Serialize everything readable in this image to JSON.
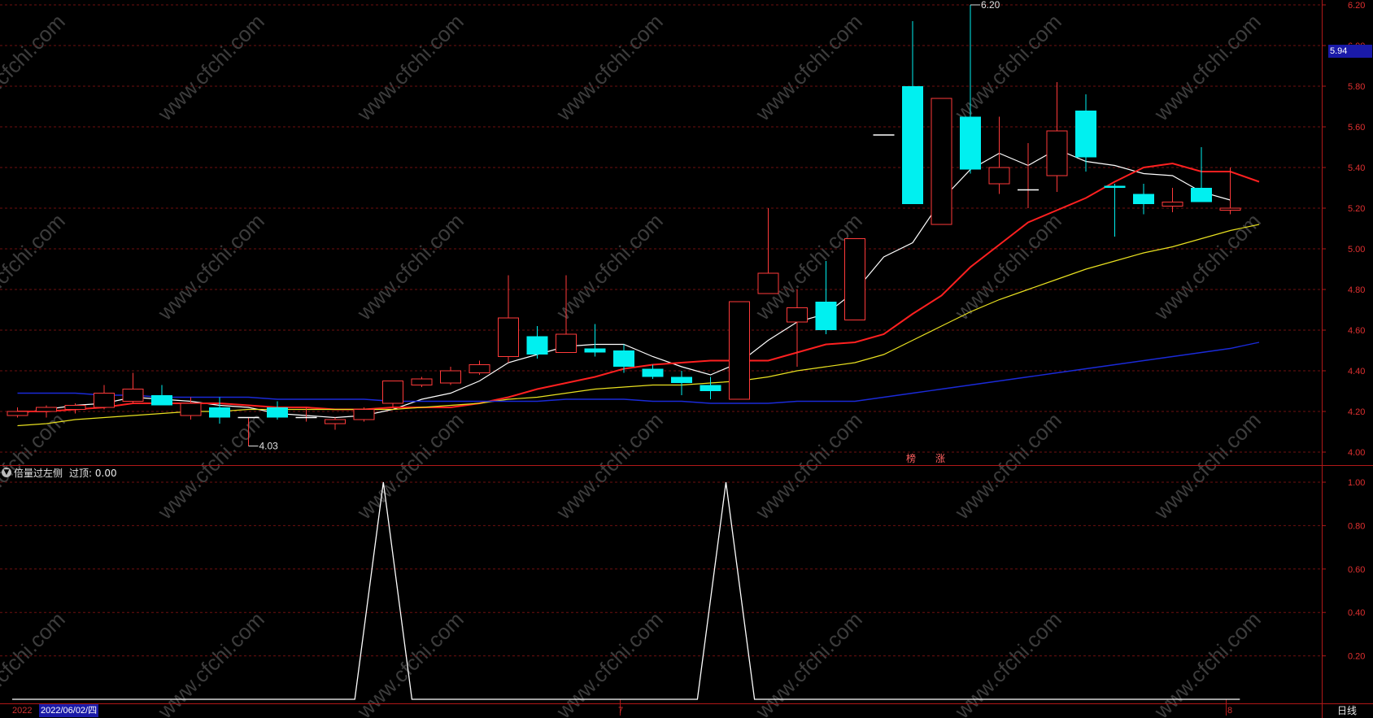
{
  "colors": {
    "background": "#000000",
    "grid": "#6e1010",
    "axis": "#b01818",
    "up_candle": "#ff3a3a",
    "down_candle": "#00f0f0",
    "ma5": "#ffffff",
    "ma10": "#ff2020",
    "ma20": "#e8e020",
    "ma60": "#1a2ad8",
    "indicator": "#ffffff",
    "price_tag_bg": "#1a1aa8"
  },
  "watermark_text": "www.cfchi.com",
  "price_tag": "5.94",
  "markers": [
    "榜",
    "涨"
  ],
  "indicator_panel": {
    "name": "倍量过左侧",
    "value_label": "过顶: 0.00",
    "collapse_icon": "chevron-down-icon"
  },
  "bottom_axis": {
    "start_label": "2022",
    "cursor_date": "2022/06/02/四",
    "mid_label": "7",
    "end_label": "8",
    "period": "日线"
  },
  "chart_data": [
    {
      "type": "candlestick",
      "ylim": [
        3.95,
        6.22
      ],
      "yticks": [
        "4.00",
        "4.20",
        "4.40",
        "4.60",
        "4.80",
        "5.00",
        "5.20",
        "5.40",
        "5.60",
        "5.80",
        "6.00",
        "6.20"
      ],
      "grid": true,
      "annotations": [
        {
          "text": "6.20",
          "index": 33,
          "value": 6.2
        },
        {
          "text": "4.03",
          "index": 8,
          "value": 4.03
        }
      ],
      "candles": [
        {
          "o": 4.18,
          "h": 4.22,
          "l": 4.17,
          "c": 4.2
        },
        {
          "o": 4.2,
          "h": 4.23,
          "l": 4.17,
          "c": 4.22
        },
        {
          "o": 4.21,
          "h": 4.24,
          "l": 4.19,
          "c": 4.23
        },
        {
          "o": 4.22,
          "h": 4.33,
          "l": 4.21,
          "c": 4.29
        },
        {
          "o": 4.25,
          "h": 4.39,
          "l": 4.24,
          "c": 4.31
        },
        {
          "o": 4.28,
          "h": 4.33,
          "l": 4.23,
          "c": 4.23
        },
        {
          "o": 4.18,
          "h": 4.27,
          "l": 4.16,
          "c": 4.24
        },
        {
          "o": 4.22,
          "h": 4.27,
          "l": 4.14,
          "c": 4.17
        },
        {
          "o": 4.17,
          "h": 4.17,
          "l": 4.03,
          "c": 4.17
        },
        {
          "o": 4.22,
          "h": 4.25,
          "l": 4.16,
          "c": 4.17
        },
        {
          "o": 4.17,
          "h": 4.22,
          "l": 4.15,
          "c": 4.17
        },
        {
          "o": 4.14,
          "h": 4.17,
          "l": 4.11,
          "c": 4.16
        },
        {
          "o": 4.16,
          "h": 4.22,
          "l": 4.15,
          "c": 4.21
        },
        {
          "o": 4.24,
          "h": 4.35,
          "l": 4.22,
          "c": 4.35
        },
        {
          "o": 4.33,
          "h": 4.37,
          "l": 4.32,
          "c": 4.36
        },
        {
          "o": 4.34,
          "h": 4.42,
          "l": 4.33,
          "c": 4.4
        },
        {
          "o": 4.39,
          "h": 4.45,
          "l": 4.38,
          "c": 4.43
        },
        {
          "o": 4.47,
          "h": 4.87,
          "l": 4.44,
          "c": 4.66
        },
        {
          "o": 4.57,
          "h": 4.62,
          "l": 4.46,
          "c": 4.48
        },
        {
          "o": 4.49,
          "h": 4.87,
          "l": 4.49,
          "c": 4.58
        },
        {
          "o": 4.51,
          "h": 4.63,
          "l": 4.47,
          "c": 4.49
        },
        {
          "o": 4.5,
          "h": 4.53,
          "l": 4.39,
          "c": 4.42
        },
        {
          "o": 4.41,
          "h": 4.43,
          "l": 4.36,
          "c": 4.37
        },
        {
          "o": 4.37,
          "h": 4.4,
          "l": 4.28,
          "c": 4.34
        },
        {
          "o": 4.33,
          "h": 4.37,
          "l": 4.26,
          "c": 4.3
        },
        {
          "o": 4.26,
          "h": 4.74,
          "l": 4.26,
          "c": 4.74
        },
        {
          "o": 4.78,
          "h": 5.2,
          "l": 4.78,
          "c": 4.88
        },
        {
          "o": 4.64,
          "h": 4.8,
          "l": 4.42,
          "c": 4.71
        },
        {
          "o": 4.74,
          "h": 4.94,
          "l": 4.58,
          "c": 4.6
        },
        {
          "o": 4.65,
          "h": 5.05,
          "l": 4.65,
          "c": 5.05
        },
        {
          "o": 5.56,
          "h": 5.56,
          "l": 5.56,
          "c": 5.56
        },
        {
          "o": 5.8,
          "h": 6.12,
          "l": 5.22,
          "c": 5.22
        },
        {
          "o": 5.12,
          "h": 5.74,
          "l": 5.12,
          "c": 5.74
        },
        {
          "o": 5.65,
          "h": 6.2,
          "l": 5.37,
          "c": 5.39
        },
        {
          "o": 5.32,
          "h": 5.65,
          "l": 5.27,
          "c": 5.4
        },
        {
          "o": 5.29,
          "h": 5.52,
          "l": 5.2,
          "c": 5.29
        },
        {
          "o": 5.36,
          "h": 5.82,
          "l": 5.28,
          "c": 5.58
        },
        {
          "o": 5.68,
          "h": 5.76,
          "l": 5.38,
          "c": 5.45
        },
        {
          "o": 5.31,
          "h": 5.32,
          "l": 5.06,
          "c": 5.3
        },
        {
          "o": 5.27,
          "h": 5.32,
          "l": 5.17,
          "c": 5.22
        },
        {
          "o": 5.21,
          "h": 5.3,
          "l": 5.18,
          "c": 5.23
        },
        {
          "o": 5.3,
          "h": 5.5,
          "l": 5.23,
          "c": 5.23
        },
        {
          "o": 5.19,
          "h": 5.4,
          "l": 5.17,
          "c": 5.2
        }
      ],
      "series": [
        {
          "values": [
            4.19,
            4.21,
            4.23,
            4.24,
            4.27,
            4.26,
            4.25,
            4.23,
            4.22,
            4.19,
            4.18,
            4.17,
            4.18,
            4.21,
            4.26,
            4.29,
            4.35,
            4.44,
            4.48,
            4.52,
            4.53,
            4.53,
            4.47,
            4.42,
            4.38,
            4.44,
            4.55,
            4.64,
            4.68,
            4.79,
            4.96,
            5.03,
            5.24,
            5.39,
            5.47,
            5.41,
            5.49,
            5.43,
            5.41,
            5.37,
            5.36,
            5.28,
            5.24
          ]
        },
        {
          "values": [
            4.2,
            4.2,
            4.21,
            4.22,
            4.24,
            4.24,
            4.24,
            4.24,
            4.23,
            4.22,
            4.22,
            4.21,
            4.21,
            4.22,
            4.22,
            4.22,
            4.24,
            4.27,
            4.31,
            4.34,
            4.37,
            4.41,
            4.43,
            4.44,
            4.45,
            4.45,
            4.45,
            4.49,
            4.53,
            4.54,
            4.58,
            4.68,
            4.77,
            4.91,
            5.02,
            5.13,
            5.19,
            5.25,
            5.33,
            5.4,
            5.42,
            5.38,
            5.38,
            5.33
          ]
        },
        {
          "values": [
            4.13,
            4.14,
            4.16,
            4.17,
            4.18,
            4.19,
            4.2,
            4.2,
            4.21,
            4.21,
            4.21,
            4.21,
            4.21,
            4.21,
            4.22,
            4.23,
            4.24,
            4.26,
            4.27,
            4.29,
            4.31,
            4.32,
            4.33,
            4.33,
            4.34,
            4.35,
            4.37,
            4.4,
            4.42,
            4.44,
            4.48,
            4.55,
            4.62,
            4.69,
            4.75,
            4.8,
            4.85,
            4.9,
            4.94,
            4.98,
            5.01,
            5.05,
            5.09,
            5.12
          ]
        },
        {
          "values": [
            4.29,
            4.29,
            4.29,
            4.28,
            4.28,
            4.27,
            4.27,
            4.27,
            4.27,
            4.26,
            4.26,
            4.26,
            4.26,
            4.25,
            4.25,
            4.25,
            4.25,
            4.25,
            4.25,
            4.26,
            4.26,
            4.26,
            4.25,
            4.25,
            4.24,
            4.24,
            4.24,
            4.25,
            4.25,
            4.25,
            4.27,
            4.29,
            4.31,
            4.33,
            4.35,
            4.37,
            4.39,
            4.41,
            4.43,
            4.45,
            4.47,
            4.49,
            4.51,
            4.54
          ]
        }
      ]
    },
    {
      "type": "line",
      "ylim": [
        0,
        1.05
      ],
      "yticks": [
        "0.20",
        "0.40",
        "0.60",
        "0.80",
        "1.00"
      ],
      "grid": true,
      "series": [
        {
          "values": [
            0,
            0,
            0,
            0,
            0,
            0,
            0,
            0,
            0,
            0,
            0,
            0,
            0,
            1,
            0,
            0,
            0,
            0,
            0,
            0,
            0,
            0,
            0,
            0,
            0,
            1,
            0,
            0,
            0,
            0,
            0,
            0,
            0,
            0,
            0,
            0,
            0,
            0,
            0,
            0,
            0,
            0,
            0,
            0
          ]
        }
      ]
    }
  ]
}
